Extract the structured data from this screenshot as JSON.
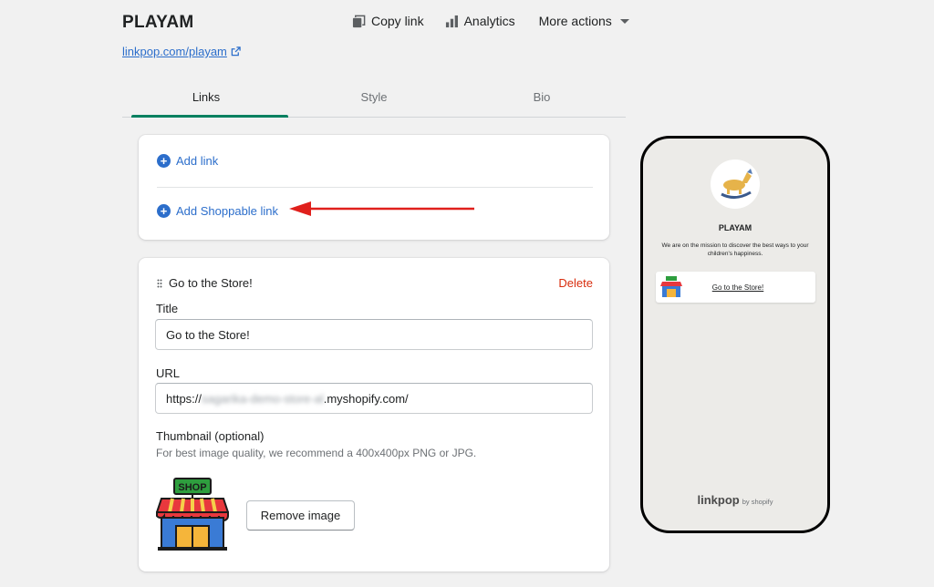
{
  "header": {
    "title": "PLAYAM",
    "page_url": "linkpop.com/playam",
    "copy_link_label": "Copy link",
    "analytics_label": "Analytics",
    "more_actions_label": "More actions"
  },
  "tabs": [
    {
      "label": "Links",
      "active": true
    },
    {
      "label": "Style",
      "active": false
    },
    {
      "label": "Bio",
      "active": false
    }
  ],
  "add_card": {
    "add_link_label": "Add link",
    "add_shoppable_label": "Add Shoppable link"
  },
  "link_card": {
    "heading": "Go to the Store!",
    "delete_label": "Delete",
    "title_label": "Title",
    "title_value": "Go to the Store!",
    "url_label": "URL",
    "url_prefix": "https://",
    "url_blurred": "sagarika-demo-store-al",
    "url_suffix": ".myshopify.com/",
    "thumbnail_label": "Thumbnail (optional)",
    "thumbnail_help": "For best image quality, we recommend a 400x400px PNG or JPG.",
    "thumbnail_sign_text": "SHOP",
    "remove_image_label": "Remove image"
  },
  "preview": {
    "name": "PLAYAM",
    "bio": "We are on the mission to discover the best ways to your children's happiness.",
    "link_label": "Go to the Store!",
    "footer_brand": "linkpop",
    "footer_by": "by shopify"
  },
  "colors": {
    "accent_green": "#008060",
    "link_blue": "#2c6ecb",
    "delete_red": "#d82c0d",
    "annotation_arrow": "#e0201c"
  }
}
